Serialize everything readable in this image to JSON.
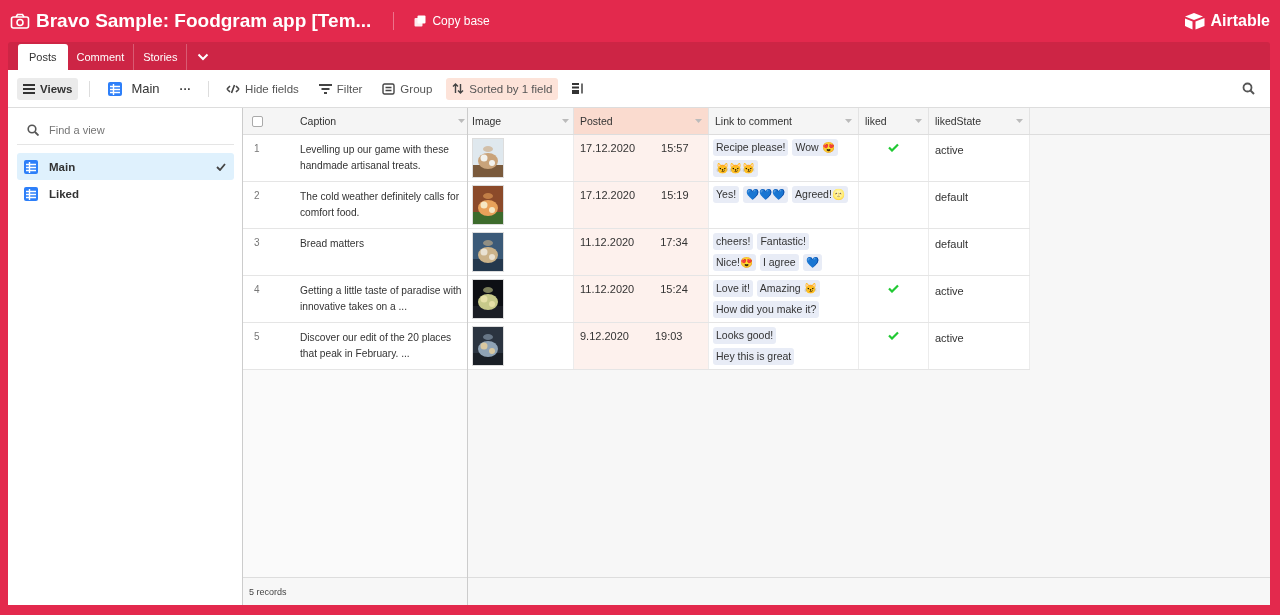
{
  "header": {
    "title": "Bravo Sample: Foodgram app [Tem...",
    "copy_button": "Copy base",
    "logo_text": "Airtable"
  },
  "tabs": [
    {
      "label": "Posts",
      "selected": true
    },
    {
      "label": "Comment",
      "selected": false
    },
    {
      "label": "Stories",
      "selected": false
    }
  ],
  "toolbar": {
    "views_button": "Views",
    "view_name": "Main",
    "more": "···",
    "hide_fields": "Hide fields",
    "filter": "Filter",
    "group": "Group",
    "sort": {
      "label": "Sorted by 1 field",
      "active": true
    }
  },
  "sidebar": {
    "search": {
      "placeholder": "Find a view"
    },
    "items": [
      {
        "label": "Main",
        "selected": true
      },
      {
        "label": "Liked",
        "selected": false
      }
    ]
  },
  "table": {
    "select_all": {
      "checked": false
    },
    "columns": [
      {
        "label": "Caption",
        "sorted": false
      },
      {
        "label": "Image",
        "sorted": false
      },
      {
        "label": "Posted",
        "sorted": true
      },
      {
        "label": "Link to comment",
        "sorted": false
      },
      {
        "label": "liked",
        "sorted": false
      },
      {
        "label": "likedState",
        "sorted": false
      }
    ],
    "rows": [
      {
        "number": "1",
        "caption": "Levelling up our game with these handmade artisanal treats.",
        "image": {
          "kind": "picture"
        },
        "date": "17.12.2020",
        "time": "15:57",
        "comments": [
          "Recipe please!",
          "Wow 😍",
          "😼😼😼"
        ],
        "liked": true,
        "liked_state": "active"
      },
      {
        "number": "2",
        "caption": "The cold weather definitely calls for comfort food.",
        "image": {
          "kind": "picture"
        },
        "date": "17.12.2020",
        "time": "15:19",
        "comments": [
          "Yes!",
          "💙💙💙",
          "Agreed!🌝"
        ],
        "liked": false,
        "liked_state": "default"
      },
      {
        "number": "3",
        "caption": "Bread matters",
        "image": {
          "kind": "picture"
        },
        "date": "11.12.2020",
        "time": "17:34",
        "comments": [
          "cheers!",
          "Fantastic!",
          "Nice!😍",
          "I agree",
          "💙"
        ],
        "liked": false,
        "liked_state": "default"
      },
      {
        "number": "4",
        "caption": "Getting a little taste of paradise with innovative takes on a ...",
        "image": {
          "kind": "picture"
        },
        "date": "11.12.2020",
        "time": "15:24",
        "comments": [
          "Love it!",
          "Amazing 😼",
          "How did you make it?"
        ],
        "liked": true,
        "liked_state": "active"
      },
      {
        "number": "5",
        "caption": "Discover our edit of the 20 places that peak in February. ...",
        "image": {
          "kind": "picture"
        },
        "date": "9.12.2020",
        "time": "19:03",
        "comments": [
          "Looks good!",
          "Hey this is great"
        ],
        "liked": true,
        "liked_state": "active"
      }
    ],
    "footer": "5 records"
  }
}
